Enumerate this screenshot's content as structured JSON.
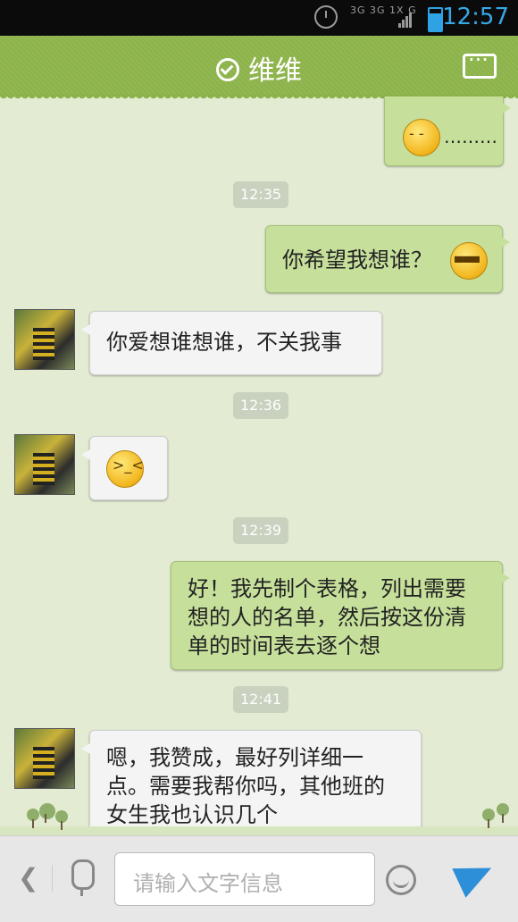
{
  "status_bar": {
    "time": "12:57",
    "network_label": "3G 3G 1X G"
  },
  "header": {
    "title": "维维"
  },
  "messages": [
    {
      "side": "right",
      "text": "………",
      "emoji": "sweat-face"
    },
    {
      "type": "time",
      "text": "12:35"
    },
    {
      "side": "right",
      "text": "你希望我想谁？",
      "emoji": "grin-face"
    },
    {
      "side": "left",
      "text": "你爱想谁想谁，不关我事"
    },
    {
      "type": "time",
      "text": "12:36"
    },
    {
      "side": "left",
      "text": "",
      "emoji": "smirk-face"
    },
    {
      "type": "time",
      "text": "12:39"
    },
    {
      "side": "right",
      "text": "好！我先制个表格，列出需要想的人的名单，然后按这份清单的时间表去逐个想"
    },
    {
      "type": "time",
      "text": "12:41"
    },
    {
      "side": "left",
      "text": "嗯，我赞成，最好列详细一点。需要我帮你吗，其他班的女生我也认识几个"
    }
  ],
  "composer": {
    "placeholder": "请输入文字信息"
  },
  "colors": {
    "header_green": "#8cb34a",
    "chat_bg": "#e3ecd3",
    "bubble_right": "#c6e09b",
    "bubble_left": "#f4f4f4",
    "send_blue": "#2d8fd7"
  }
}
